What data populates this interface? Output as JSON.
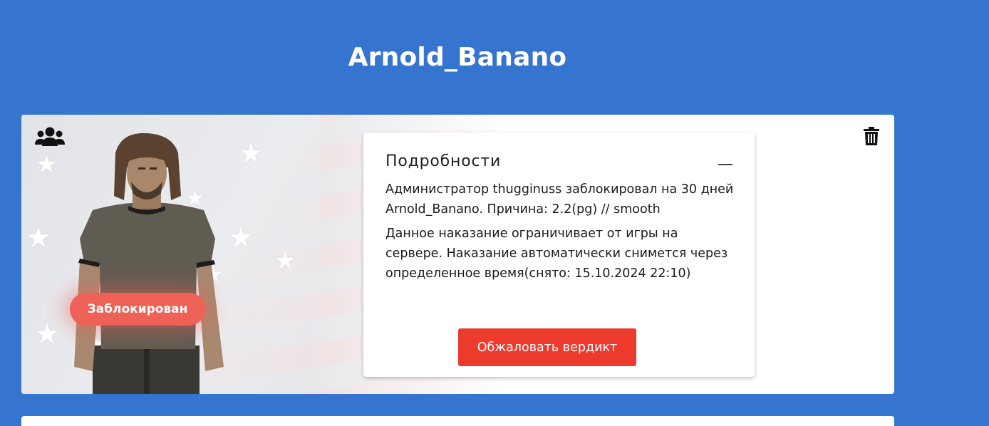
{
  "header": {
    "player_name": "Arnold_Banano"
  },
  "card": {
    "status_badge": "Заблокирован",
    "details": {
      "title": "Подробности",
      "paragraph1": "Администратор thugginuss заблокировал на 30 дней Arnold_Banano. Причина: 2.2(pg) // smooth",
      "paragraph2": "Данное наказание ограничивает от игры на сервере. Наказание автоматически снимется через определенное время(снято: 15.10.2024 22:10)",
      "appeal_label": "Обжаловать вердикт"
    },
    "icons": {
      "group": "users-group-icon",
      "delete": "trash-icon",
      "collapse": "minus-icon"
    }
  },
  "colors": {
    "background": "#3575d0",
    "badge": "#ee6156",
    "appeal_button": "#ec3a2c"
  }
}
